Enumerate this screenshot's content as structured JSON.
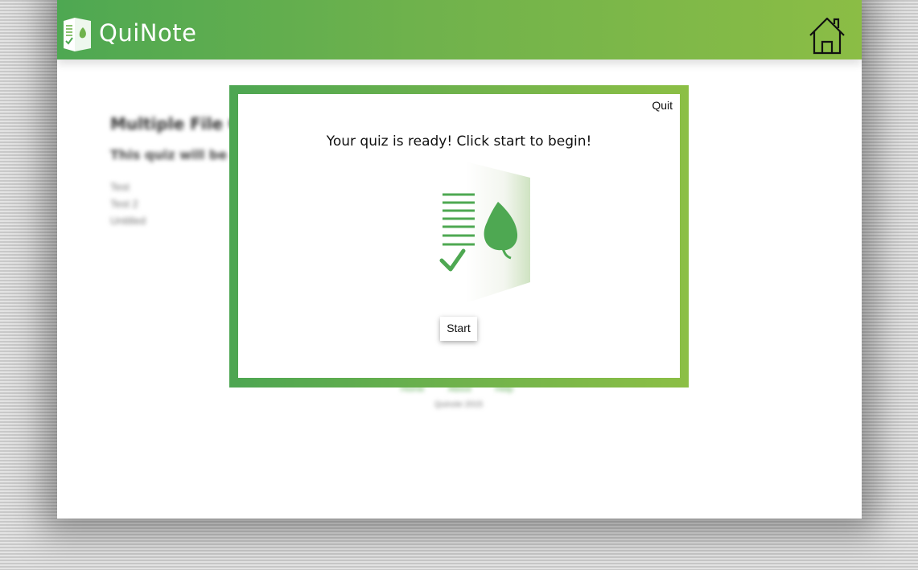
{
  "app": {
    "name": "QuiNote"
  },
  "header": {
    "home_icon": "home-icon",
    "logo_icon": "quinote-logo-icon"
  },
  "page": {
    "title": "Multiple File Q",
    "subtitle": "This quiz will be p",
    "files": [
      "Test",
      "Test 2",
      "Untitled"
    ],
    "footer_links": [
      "Home",
      "About",
      "Help"
    ],
    "footer_copy": "Quinote 2015"
  },
  "modal": {
    "quit_label": "Quit",
    "message": "Your quiz is ready! Click start to begin!",
    "start_label": "Start",
    "illustration_icon": "quiz-note-icon"
  },
  "colors": {
    "brand_green": "#4ea852",
    "brand_lime": "#8bbd45"
  }
}
